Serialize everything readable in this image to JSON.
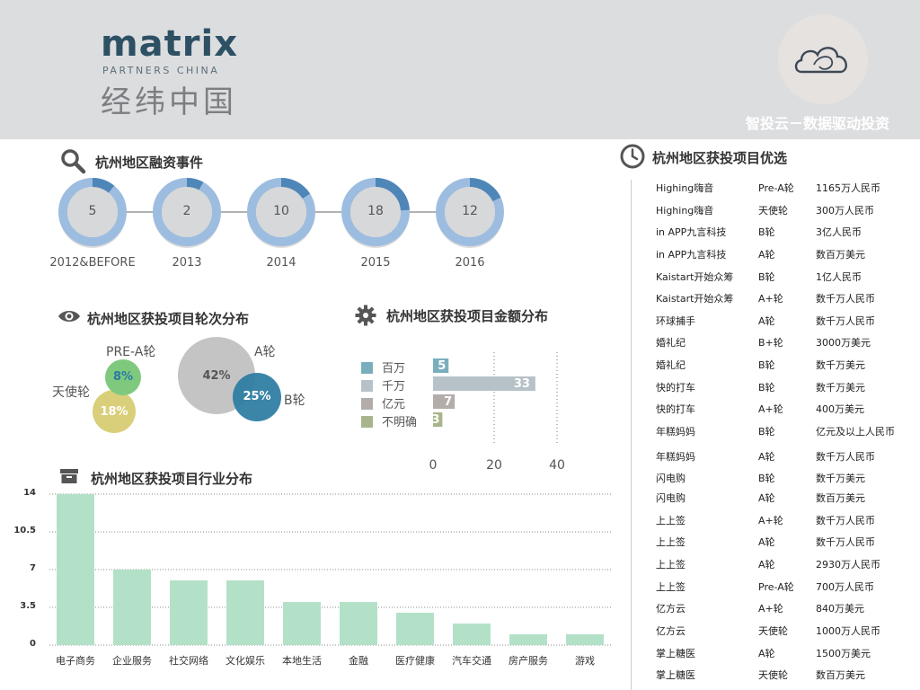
{
  "header": {
    "logo_main": "matrix",
    "logo_sub": "PARTNERS CHINA",
    "logo_cn": "经纬中国",
    "tagline": "智投云－数据驱动投资"
  },
  "events": {
    "title": "杭州地区融资事件",
    "items": [
      {
        "label": "2012&BEFORE",
        "value": "5"
      },
      {
        "label": "2013",
        "value": "2"
      },
      {
        "label": "2014",
        "value": "10"
      },
      {
        "label": "2015",
        "value": "18"
      },
      {
        "label": "2016",
        "value": "12"
      }
    ]
  },
  "rounds": {
    "title": "杭州地区获投项目轮次分布",
    "items": [
      {
        "name": "PRE-A轮",
        "pct": "8%",
        "color": "#7fc97f"
      },
      {
        "name": "天使轮",
        "pct": "18%",
        "color": "#d9cf7a"
      },
      {
        "name": "A轮",
        "pct": "42%",
        "color": "#c5c4c4"
      },
      {
        "name": "B轮",
        "pct": "25%",
        "color": "#2a7ba2"
      }
    ]
  },
  "chart_data": [
    {
      "type": "bar",
      "title": "杭州地区获投项目金额分布",
      "orientation": "horizontal",
      "categories": [
        "百万",
        "千万",
        "亿元",
        "不明确"
      ],
      "values": [
        5,
        33,
        7,
        3
      ],
      "colors": [
        "#7aaebd",
        "#b7c2c8",
        "#b3acab",
        "#a8b58c"
      ],
      "xticks": [
        "0",
        "20",
        "40"
      ],
      "xlim": [
        0,
        40
      ]
    },
    {
      "type": "bar",
      "title": "杭州地区获投项目行业分布",
      "categories": [
        "电子商务",
        "企业服务",
        "社交网络",
        "文化娱乐",
        "本地生活",
        "金融",
        "医疗健康",
        "汽车交通",
        "房产服务",
        "游戏"
      ],
      "values": [
        14,
        7,
        6,
        6,
        4,
        4,
        3,
        2,
        1,
        1
      ],
      "yticks": [
        "14",
        "10.5",
        "7",
        "3.5",
        "0"
      ],
      "ylim": [
        0,
        14
      ],
      "color": "#b3e1c8"
    }
  ],
  "projects": {
    "title": "杭州地区获投项目优选",
    "rows": [
      {
        "name": "Highing嗨音",
        "round": "Pre-A轮",
        "amount": "1165万人民币"
      },
      {
        "name": "Highing嗨音",
        "round": "天使轮",
        "amount": "300万人民币"
      },
      {
        "name": "in APP九言科技",
        "round": "B轮",
        "amount": "3亿人民币"
      },
      {
        "name": "in APP九言科技",
        "round": "A轮",
        "amount": "数百万美元"
      },
      {
        "name": "Kaistart开始众筹",
        "round": "B轮",
        "amount": "1亿人民币"
      },
      {
        "name": "Kaistart开始众筹",
        "round": "A+轮",
        "amount": "数千万人民币"
      },
      {
        "name": "环球捕手",
        "round": "A轮",
        "amount": "数千万人民币"
      },
      {
        "name": "婚礼纪",
        "round": "B+轮",
        "amount": "3000万美元"
      },
      {
        "name": "婚礼纪",
        "round": "B轮",
        "amount": "数千万美元"
      },
      {
        "name": "快的打车",
        "round": "B轮",
        "amount": "数千万美元"
      },
      {
        "name": "快的打车",
        "round": "A+轮",
        "amount": "400万美元"
      },
      {
        "name": "年糕妈妈",
        "round": "B轮",
        "amount": "亿元及以上人民币"
      },
      {
        "name": "年糕妈妈",
        "round": "A轮",
        "amount": "数千万人民币"
      },
      {
        "name": "闪电购",
        "round": "B轮",
        "amount": "数千万美元"
      },
      {
        "name": "闪电购",
        "round": "A轮",
        "amount": "数百万美元"
      },
      {
        "name": "上上签",
        "round": "A+轮",
        "amount": "数千万人民币"
      },
      {
        "name": "上上签",
        "round": "A轮",
        "amount": "数千万人民币"
      },
      {
        "name": "上上签",
        "round": "A轮",
        "amount": "2930万人民币"
      },
      {
        "name": "上上签",
        "round": "Pre-A轮",
        "amount": "700万人民币"
      },
      {
        "name": "亿方云",
        "round": "A+轮",
        "amount": "840万美元"
      },
      {
        "name": "亿方云",
        "round": "天使轮",
        "amount": "1000万人民币"
      },
      {
        "name": "掌上糖医",
        "round": "A轮",
        "amount": "1500万美元"
      },
      {
        "name": "掌上糖医",
        "round": "天使轮",
        "amount": "数百万美元"
      }
    ]
  },
  "icons": [
    "search-icon",
    "eye-icon",
    "gear-icon",
    "archive-icon",
    "clock-icon",
    "cloud-logo-icon"
  ]
}
